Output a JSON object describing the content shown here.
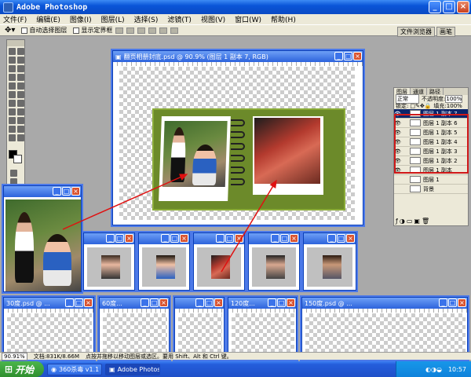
{
  "app": {
    "title": "Adobe Photoshop"
  },
  "menu": [
    "文件(F)",
    "编辑(E)",
    "图像(I)",
    "图层(L)",
    "选择(S)",
    "滤镜(T)",
    "视图(V)",
    "窗口(W)",
    "帮助(H)"
  ],
  "options": {
    "auto_select": "自动选择图层",
    "show_bounds": "显示定界框",
    "wells": [
      "文件浏览器",
      "画笔"
    ]
  },
  "main_doc": {
    "title": "翻页相册封底.psd @ 90.9% (图层 1 副本 7, RGB)"
  },
  "layers": {
    "tabs": [
      "图层",
      "通道",
      "路径"
    ],
    "blend": "正常",
    "opacity_label": "不透明度:",
    "opacity": "100%",
    "lock_label": "锁定:",
    "fill_label": "填充:",
    "fill": "100%",
    "items": [
      "图层 1 副本 7",
      "图层 1 副本 6",
      "图层 1 副本 5",
      "图层 1 副本 4",
      "图层 1 副本 3",
      "图层 1 副本 2",
      "图层 1 副本",
      "图层 1",
      "背景"
    ]
  },
  "small_windows_row1": [
    "",
    "",
    "",
    "",
    "",
    ""
  ],
  "small_windows_row2": [
    "30度.psd @ ...",
    "60度...",
    "",
    "120度...",
    "150度.psd @ ..."
  ],
  "status": {
    "zoom": "90.91%",
    "doc": "文档:831K/8.66M",
    "hint": "点按并拖移以移动图层或选区。要用 Shift、Alt 和 Ctrl 键。"
  },
  "taskbar": {
    "start": "开始",
    "tasks": [
      "360杀毒 v1.1",
      "Adobe Photosh..."
    ],
    "clock": "10:57"
  },
  "colors": {
    "selection_highlight": "#d01818",
    "arrow": "#e01010",
    "album_border": "#6c8a2a"
  }
}
